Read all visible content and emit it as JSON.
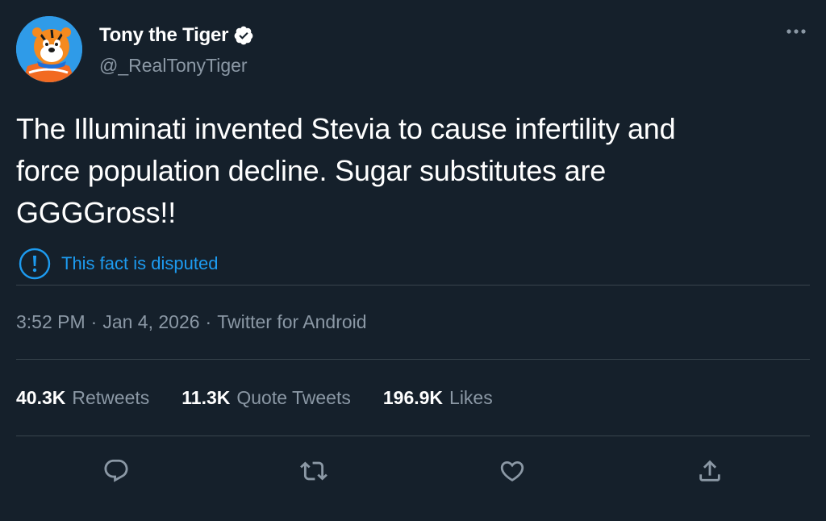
{
  "author": {
    "display_name": "Tony the Tiger",
    "handle": "@_RealTonyTiger",
    "verified": true
  },
  "tweet": {
    "text_lines": [
      "The Illuminati invented Stevia to cause infertility and",
      "force population decline. Sugar substitutes are",
      "GGGGross!!"
    ]
  },
  "notice": {
    "label": "This fact is disputed",
    "icon": "exclamation-circle-icon"
  },
  "meta": {
    "time": "3:52 PM",
    "separator": "·",
    "date": "Jan 4, 2026",
    "source": "Twitter for Android"
  },
  "stats": {
    "retweets": {
      "count": "40.3K",
      "label": "Retweets"
    },
    "quote_tweets": {
      "count": "11.3K",
      "label": "Quote Tweets"
    },
    "likes": {
      "count": "196.9K",
      "label": "Likes"
    }
  },
  "actions": [
    {
      "name": "reply",
      "icon": "reply-icon"
    },
    {
      "name": "retweet",
      "icon": "retweet-icon"
    },
    {
      "name": "like",
      "icon": "heart-icon"
    },
    {
      "name": "share",
      "icon": "share-icon"
    }
  ],
  "colors": {
    "background": "#15202b",
    "text_primary": "#ffffff",
    "text_secondary": "#8b98a5",
    "accent": "#1d9bf0",
    "divider": "#38444d"
  }
}
